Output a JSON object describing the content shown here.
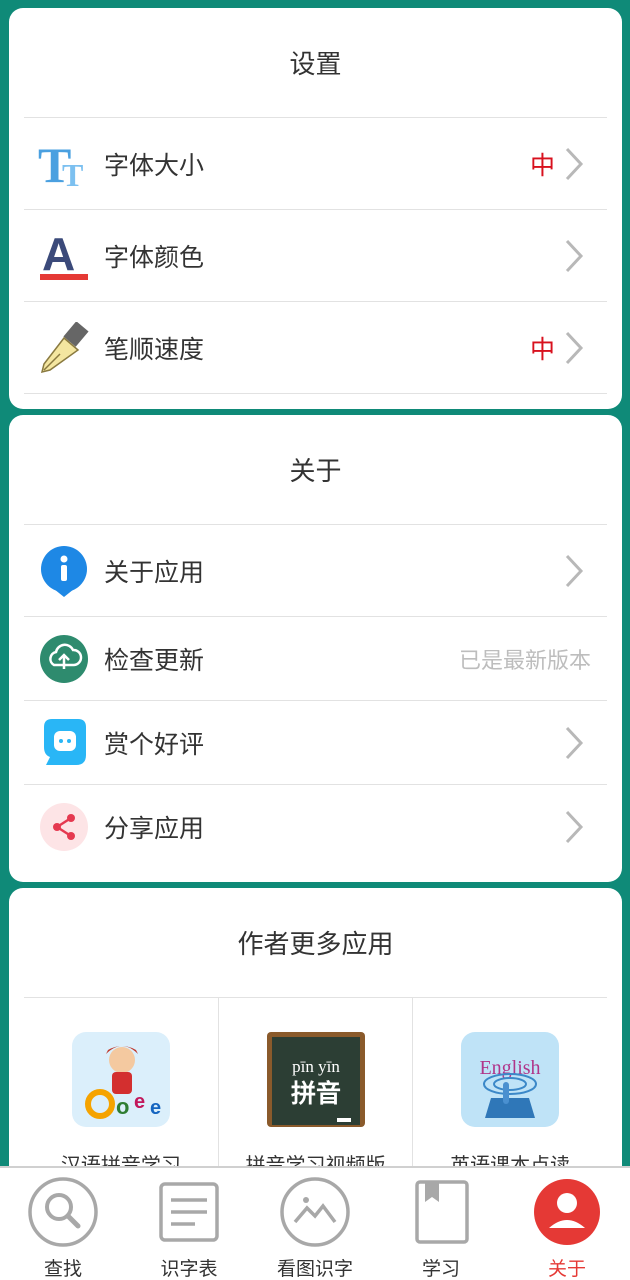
{
  "settings": {
    "title": "设置",
    "items": [
      {
        "label": "字体大小",
        "value": "中"
      },
      {
        "label": "字体颜色",
        "value": ""
      },
      {
        "label": "笔顺速度",
        "value": "中"
      }
    ]
  },
  "about": {
    "title": "关于",
    "items": [
      {
        "label": "关于应用",
        "value": ""
      },
      {
        "label": "检查更新",
        "value": "已是最新版本"
      },
      {
        "label": "赏个好评",
        "value": ""
      },
      {
        "label": "分享应用",
        "value": ""
      }
    ]
  },
  "more_apps": {
    "title": "作者更多应用",
    "apps": [
      {
        "name": "汉语拼音学习"
      },
      {
        "name": "拼音学习视频版",
        "icon_text_top": "pīn yīn",
        "icon_text_bottom": "拼音"
      },
      {
        "name": "英语课本点读",
        "icon_text": "English"
      }
    ]
  },
  "bottom_nav": {
    "tabs": [
      {
        "label": "查找",
        "icon": "search-icon"
      },
      {
        "label": "识字表",
        "icon": "list-icon"
      },
      {
        "label": "看图识字",
        "icon": "image-icon"
      },
      {
        "label": "学习",
        "icon": "book-icon"
      },
      {
        "label": "关于",
        "icon": "user-icon"
      }
    ],
    "active_index": 4
  },
  "colors": {
    "background": "#0f8a78",
    "accent_red": "#d8111e",
    "active_tab": "#e53935"
  }
}
